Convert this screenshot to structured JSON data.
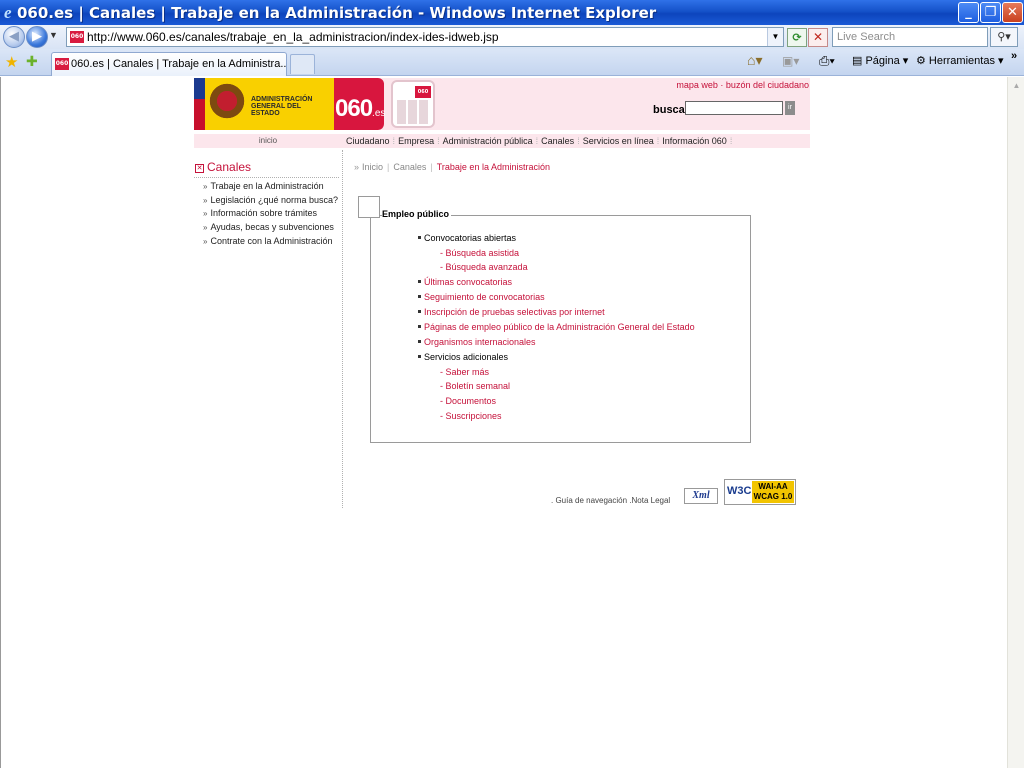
{
  "window": {
    "title": "060.es | Canales | Trabaje en la Administración - Windows Internet Explorer"
  },
  "addressbar": {
    "url": "http://www.060.es/canales/trabaje_en_la_administracion/index-ides-idweb.jsp",
    "search_placeholder": "Live Search"
  },
  "tab": {
    "label": "060.es | Canales | Trabaje en la Administra...",
    "favicon": "060"
  },
  "toolbar": {
    "page_label": "Página",
    "tools_label": "Herramientas",
    "more": "»"
  },
  "site": {
    "age_logo_text": "ADMINISTRACIÓN GENERAL DEL ESTADO",
    "logo_060": "060",
    "logo_060_suffix": ".es",
    "phone_screen": "060",
    "top_links": "mapa web · buzón del ciudadano",
    "search_label": "buscar",
    "search_button": "ir",
    "nav_inicio": "inicio",
    "nav": [
      "Ciudadano",
      "Empresa",
      "Administración pública",
      "Canales",
      "Servicios en línea",
      "Información 060"
    ]
  },
  "sidebar": {
    "title": "Canales",
    "items": [
      "Trabaje en la Administración",
      "Legislación ¿qué norma busca?",
      "Información sobre trámites",
      "Ayudas, becas y subvenciones",
      "Contrate con la Administración"
    ]
  },
  "breadcrumb": {
    "items": [
      "Inicio",
      "Canales",
      "Trabaje en la Administración"
    ]
  },
  "empleo": {
    "title": "Empleo público",
    "convocatorias": "Convocatorias abiertas",
    "busqueda_asistida": "Búsqueda asistida",
    "busqueda_avanzada": "Búsqueda avanzada",
    "ultimas": "Últimas convocatorias",
    "seguimiento": "Seguimiento de convocatorias",
    "inscripcion": "Inscripción de pruebas selectivas por internet",
    "paginas": "Páginas de empleo público de la Administración General del Estado",
    "organismos": "Organismos internacionales",
    "servicios": "Servicios adicionales",
    "saber_mas": "Saber más",
    "boletin": "Boletín semanal",
    "documentos": "Documentos",
    "suscripciones": "Suscripciones"
  },
  "footer": {
    "links": ". Guía de navegación .Nota Legal",
    "xml_badge": "Xml",
    "w3c": "W3C",
    "wai_line1": "WAI-AA",
    "wai_line2": "WCAG 1.0"
  },
  "colors": {
    "accent": "#c5113a",
    "banner_bg": "#fce6ec",
    "logo_yellow": "#f9d000"
  }
}
